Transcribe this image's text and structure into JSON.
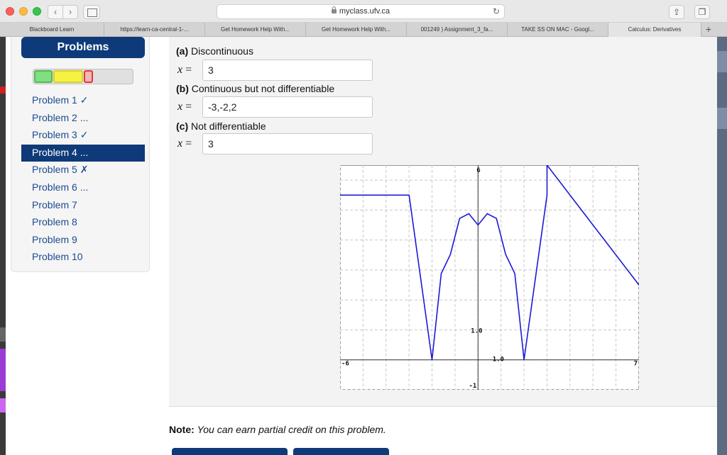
{
  "browser": {
    "url": "myclass.ufv.ca",
    "tabs": [
      {
        "label": "Blackboard Learn"
      },
      {
        "label": "https://learn-ca-central-1-..."
      },
      {
        "label": "Get Homework Help With..."
      },
      {
        "label": "Get Homework Help With..."
      },
      {
        "label": "001249 ) Assignment_3_fa..."
      },
      {
        "label": "TAKE SS ON MAC - Googl..."
      },
      {
        "label": "Calculus: Derivatives"
      }
    ]
  },
  "sidebar": {
    "title": "Problems",
    "progress_segments": [
      "correct",
      "partial",
      "incorrect"
    ],
    "problems": [
      {
        "label": "Problem 1 ✓"
      },
      {
        "label": "Problem 2 ..."
      },
      {
        "label": "Problem 3 ✓"
      },
      {
        "label": "Problem 4 ..."
      },
      {
        "label": "Problem 5 ✗"
      },
      {
        "label": "Problem 6 ..."
      },
      {
        "label": "Problem 7"
      },
      {
        "label": "Problem 8"
      },
      {
        "label": "Problem 9"
      },
      {
        "label": "Problem 10"
      }
    ],
    "current_problem": 4
  },
  "questions": [
    {
      "part": "(a)",
      "text": "Discontinuous",
      "var": "x",
      "value": "3"
    },
    {
      "part": "(b)",
      "text": "Continuous but not differentiable",
      "var": "x",
      "value": "-3,-2,2"
    },
    {
      "part": "(c)",
      "text": "Not differentiable",
      "var": "x",
      "value": "3"
    }
  ],
  "graph": {
    "x_min_label": "-6",
    "x_max_label": "7",
    "y_max_label": "6",
    "y_min_label": "-1",
    "y_tick_label": "1.0",
    "x_tick_label": "1.0",
    "line_color": "#1a1ad6"
  },
  "chart_data": {
    "type": "line",
    "xlim": [
      -6,
      7
    ],
    "ylim": [
      -1,
      6.5
    ],
    "x": [
      -6,
      -3,
      -2,
      -1.6,
      -1.2,
      -0.8,
      -0.4,
      0,
      0.4,
      0.8,
      1.2,
      1.6,
      2,
      3,
      3,
      7
    ],
    "y": [
      5.5,
      5.5,
      0,
      2.88,
      3.52,
      4.72,
      4.88,
      4.5,
      4.88,
      4.72,
      3.52,
      2.88,
      0,
      5.5,
      6.5,
      2.5
    ]
  },
  "note": {
    "label": "Note:",
    "text": "You can earn partial credit on this problem."
  }
}
